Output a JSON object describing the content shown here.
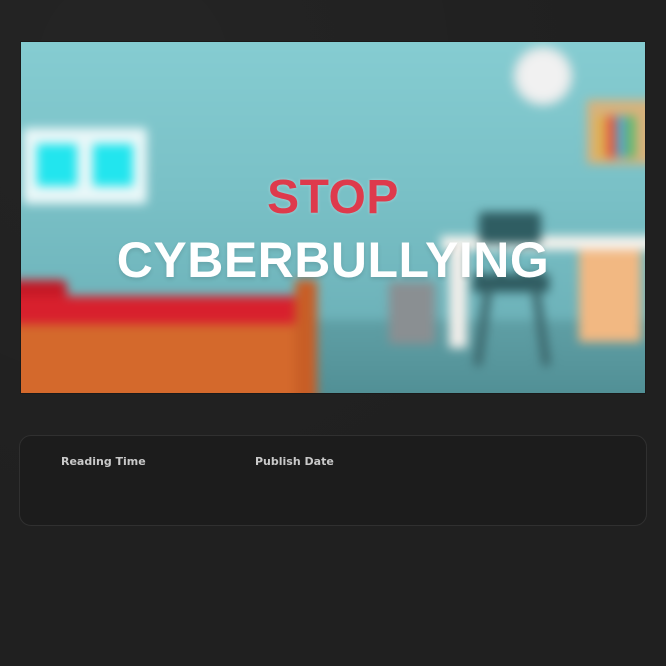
{
  "hero": {
    "headline_line1": "STOP",
    "headline_line2": "CYBERBULLYING",
    "accent_color": "#de3a4c"
  },
  "meta": {
    "reading_time_label": "Reading Time",
    "publish_date_label": "Publish Date"
  },
  "theme": {
    "page_background": "#202020",
    "card_background": "#1c1c1c"
  }
}
